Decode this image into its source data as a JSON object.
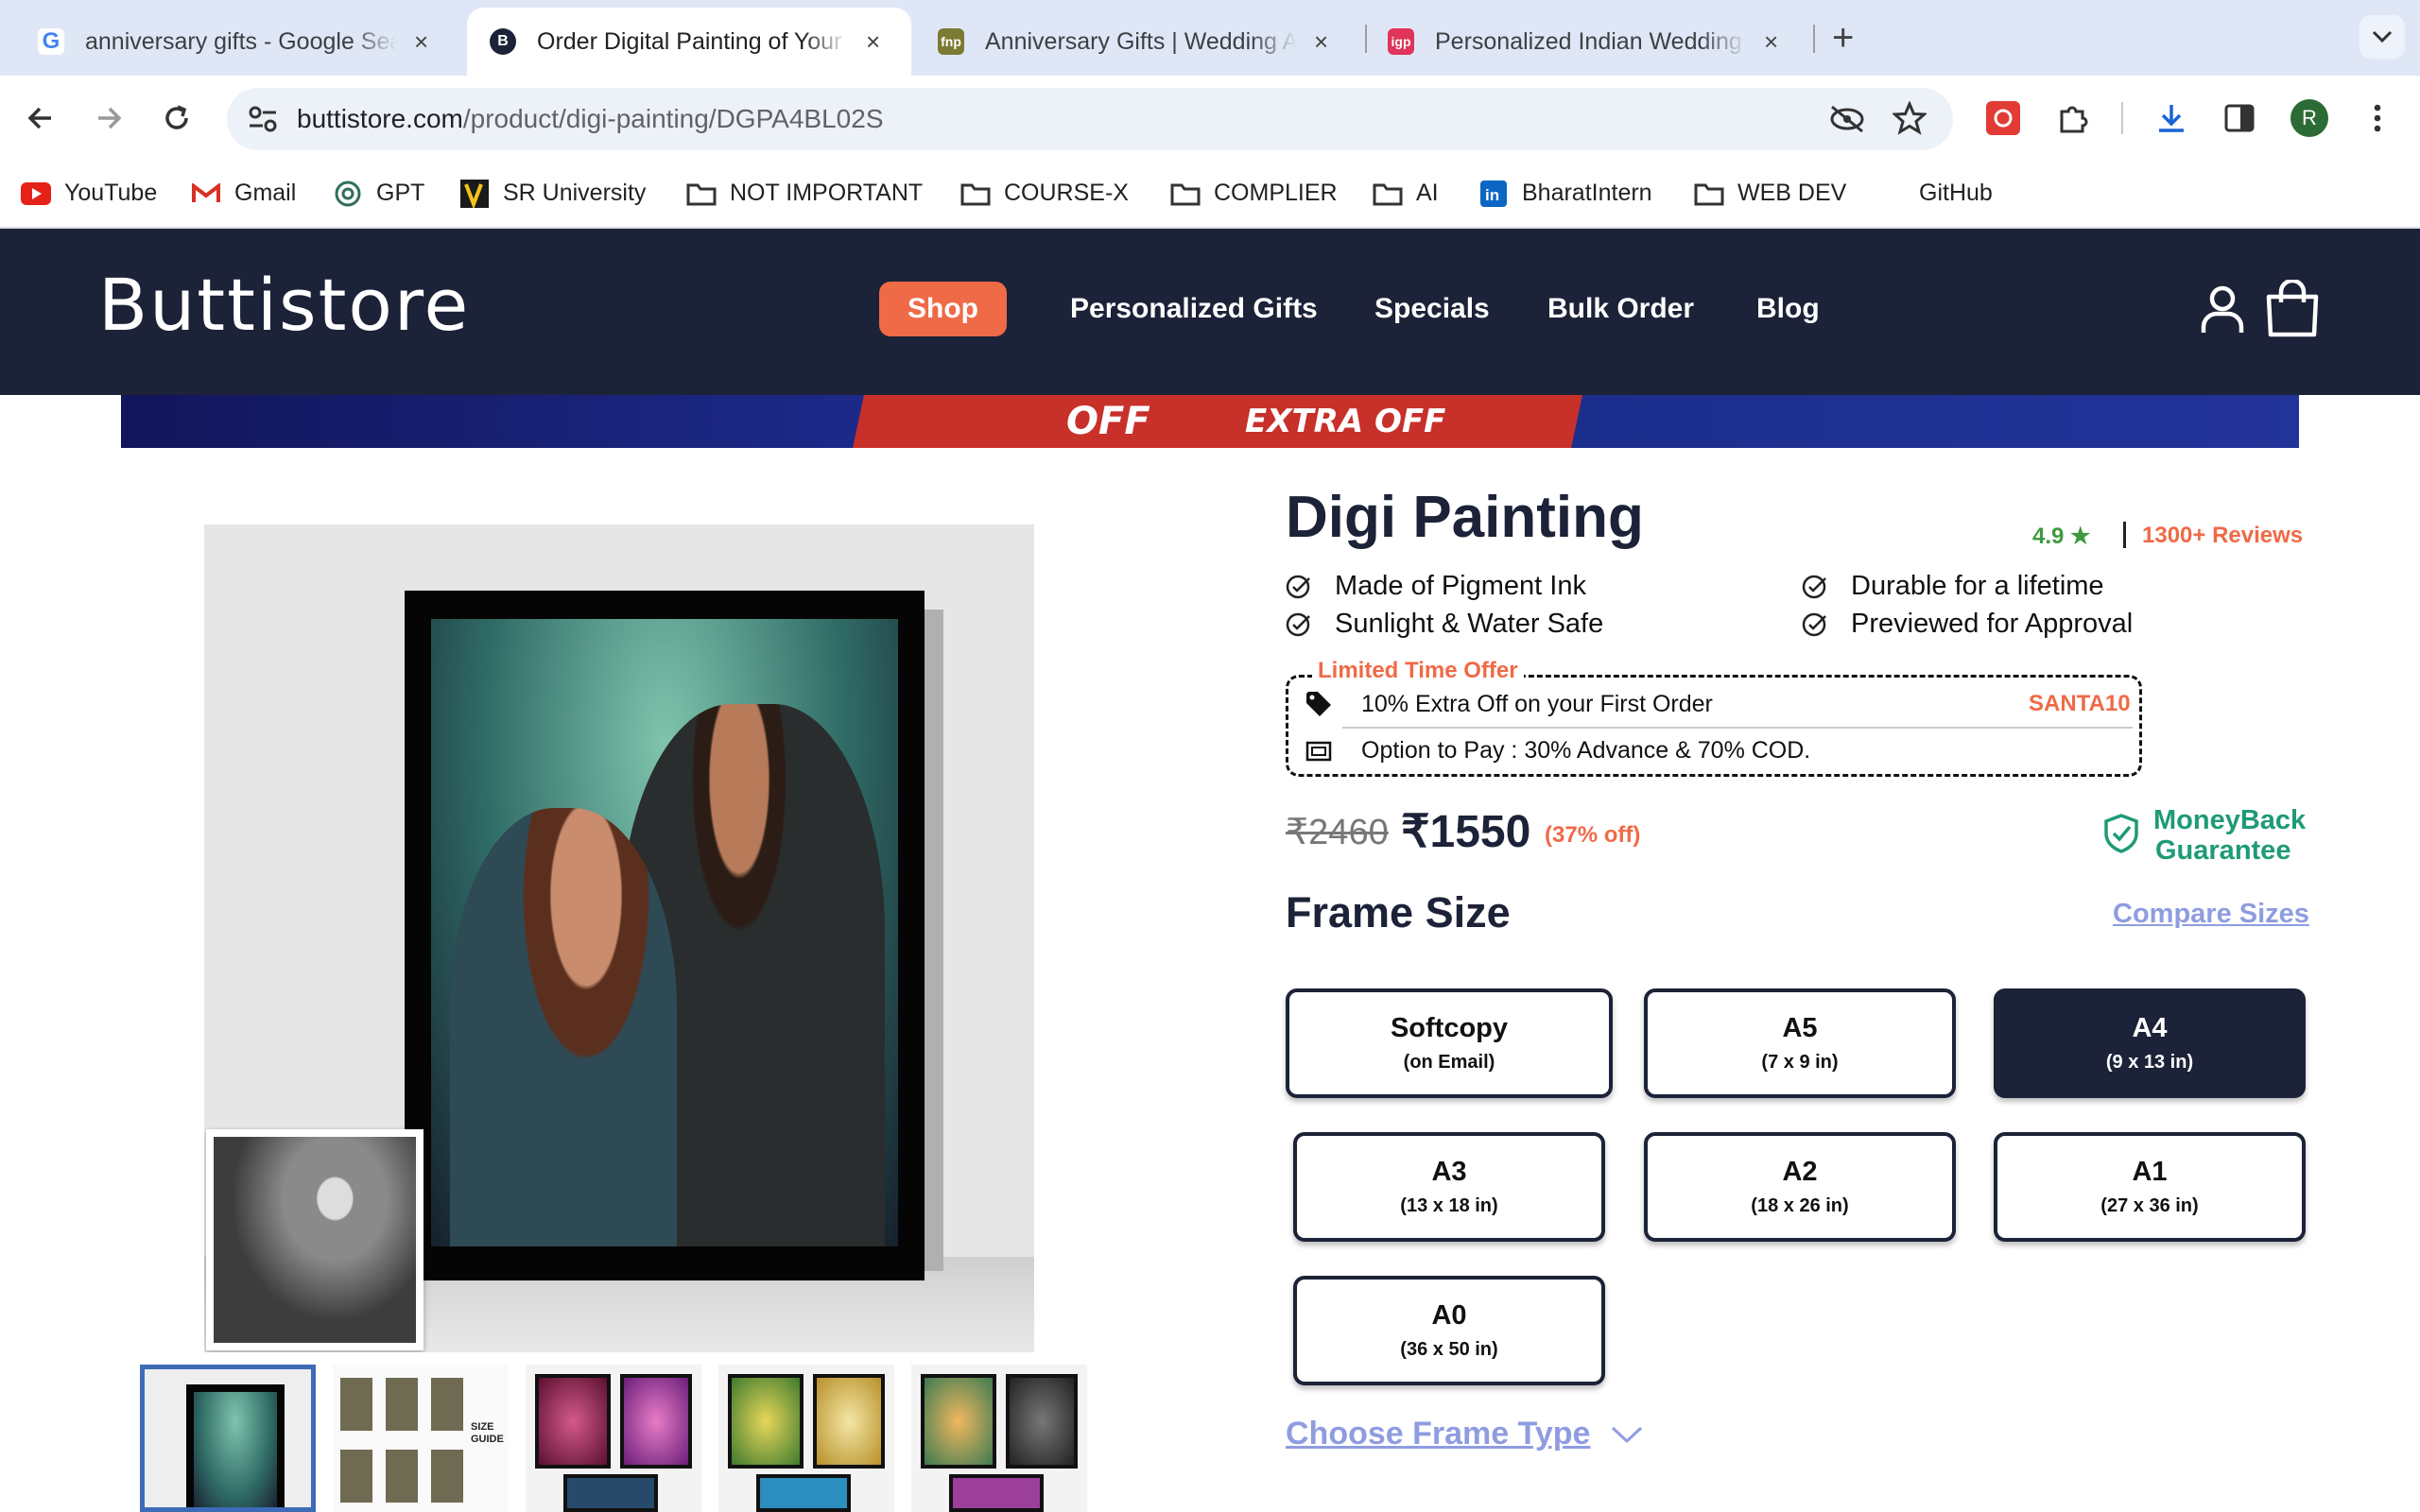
{
  "browser": {
    "tabs": [
      {
        "title": "anniversary gifts - Google Search",
        "favicon": "google-icon",
        "close": "×"
      },
      {
        "title": "Order Digital Painting of Your Photo",
        "favicon": "buttistore-icon",
        "close": "×",
        "active": true
      },
      {
        "title": "Anniversary Gifts | Wedding Anniversary Gifts",
        "favicon": "fnp-icon",
        "close": "×"
      },
      {
        "title": "Personalized Indian Wedding Gifts",
        "favicon": "igp-icon",
        "close": "×"
      }
    ],
    "url_domain": "buttistore.com",
    "url_path": "/product/digi-painting/DGPA4BL02S",
    "profile_initial": "R",
    "bookmarks": [
      {
        "label": "YouTube",
        "icon": "youtube-icon"
      },
      {
        "label": "Gmail",
        "icon": "gmail-icon"
      },
      {
        "label": "GPT",
        "icon": "chatgpt-icon"
      },
      {
        "label": "SR University",
        "icon": "sr-university-icon"
      },
      {
        "label": "NOT IMPORTANT",
        "icon": "folder-icon"
      },
      {
        "label": "COURSE-X",
        "icon": "folder-icon"
      },
      {
        "label": "COMPLIER",
        "icon": "folder-icon"
      },
      {
        "label": "AI",
        "icon": "folder-icon"
      },
      {
        "label": "BharatIntern",
        "icon": "linkedin-icon"
      },
      {
        "label": "WEB DEV",
        "icon": "folder-icon"
      },
      {
        "label": "GitHub",
        "icon": ""
      }
    ]
  },
  "site": {
    "logo": "Buttistore",
    "nav": {
      "shop": "Shop",
      "personalized": "Personalized Gifts",
      "specials": "Specials",
      "bulk": "Bulk Order",
      "blog": "Blog"
    },
    "banner": {
      "off": "OFF",
      "extra_off": "EXTRA OFF"
    }
  },
  "product": {
    "title": "Digi Painting",
    "rating": "4.9 ★",
    "reviews": "1300+ Reviews",
    "features": [
      "Made of Pigment Ink",
      "Durable for a lifetime",
      "Sunlight & Water Safe",
      "Previewed for Approval"
    ],
    "offer": {
      "legend": "Limited Time Offer",
      "line1": "10% Extra Off on your First Order",
      "code": "SANTA10",
      "line2": "Option to Pay : 30% Advance & 70% COD."
    },
    "mrp": "₹2460",
    "price": "₹1550",
    "discount": "(37% off)",
    "guarantee_line1": "MoneyBack",
    "guarantee_line2": "Guarantee",
    "frame_size_heading": "Frame Size",
    "compare_sizes": "Compare Sizes",
    "sizes": [
      {
        "name": "Softcopy",
        "dims": "(on Email)"
      },
      {
        "name": "A5",
        "dims": "(7 x 9 in)"
      },
      {
        "name": "A4",
        "dims": "(9 x 13 in)",
        "selected": true
      },
      {
        "name": "A3",
        "dims": "(13 x 18 in)"
      },
      {
        "name": "A2",
        "dims": "(18 x 26 in)"
      },
      {
        "name": "A1",
        "dims": "(27 x 36 in)"
      },
      {
        "name": "A0",
        "dims": "(36 x 50 in)"
      }
    ],
    "choose_frame_type": "Choose Frame Type",
    "thumb_size_guide": "SIZE GUIDE"
  },
  "colors": {
    "navy": "#1c2237",
    "accent": "#ef6a47",
    "link": "#8f9ce0",
    "green": "#1f9a77"
  }
}
